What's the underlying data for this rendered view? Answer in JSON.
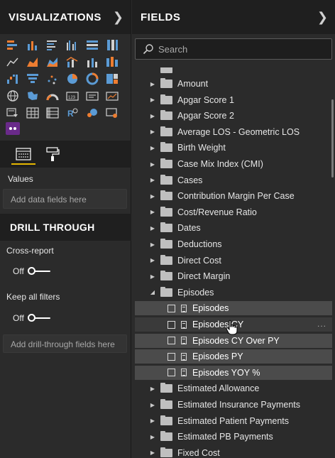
{
  "visualizations": {
    "title": "VISUALIZATIONS",
    "icons": [
      "stacked-bar-icon",
      "stacked-column-icon",
      "clustered-bar-icon",
      "clustered-column-icon",
      "100-bar-icon",
      "100-column-icon",
      "line-chart-icon",
      "area-chart-icon",
      "stacked-area-icon",
      "line-column-icon",
      "line-column-2-icon",
      "ribbon-chart-icon",
      "waterfall-icon",
      "funnel-icon",
      "scatter-icon",
      "pie-icon",
      "donut-icon",
      "treemap-icon",
      "map-icon",
      "filled-map-icon",
      "gauge-icon",
      "card-icon",
      "multirow-card-icon",
      "kpi-icon",
      "slicer-icon",
      "table-icon",
      "matrix-icon",
      "r-visual-icon",
      "arcgis-icon",
      "custom-visual-icon"
    ],
    "extra_icon": "custom-visual-extra-icon",
    "colors": {
      "accent": "#e6b800",
      "bar_blue": "#5b9bd5",
      "bar_orange": "#ed7d31",
      "purple": "#6a2a8a"
    }
  },
  "tabs": {
    "fields_tab_icon": "fields-tab-icon",
    "format_tab_icon": "paint-roller-icon"
  },
  "values_well": {
    "label": "Values",
    "placeholder": "Add data fields here"
  },
  "drill_through": {
    "title": "DRILL THROUGH",
    "cross_report": {
      "label": "Cross-report",
      "state": "Off"
    },
    "keep_filters": {
      "label": "Keep all filters",
      "state": "Off"
    },
    "well_placeholder": "Add drill-through fields here"
  },
  "fields": {
    "title": "FIELDS",
    "search_placeholder": "Search",
    "folders_before": [
      "Amount",
      "Apgar Score 1",
      "Apgar Score 2",
      "Average LOS - Geometric LOS",
      "Birth Weight",
      "Case Mix Index (CMI)",
      "Cases",
      "Contribution Margin Per Case",
      "Cost/Revenue Ratio",
      "Dates",
      "Deductions",
      "Direct Cost",
      "Direct Margin"
    ],
    "expanded_folder": "Episodes",
    "measures": [
      "Episodes",
      "Episodes CY",
      "Episodes CY Over PY",
      "Episodes PY",
      "Episodes YOY %"
    ],
    "more_label": "...",
    "folders_after": [
      "Estimated Allowance",
      "Estimated Insurance Payments",
      "Estimated Patient Payments",
      "Estimated PB Payments",
      "Fixed Cost"
    ]
  }
}
